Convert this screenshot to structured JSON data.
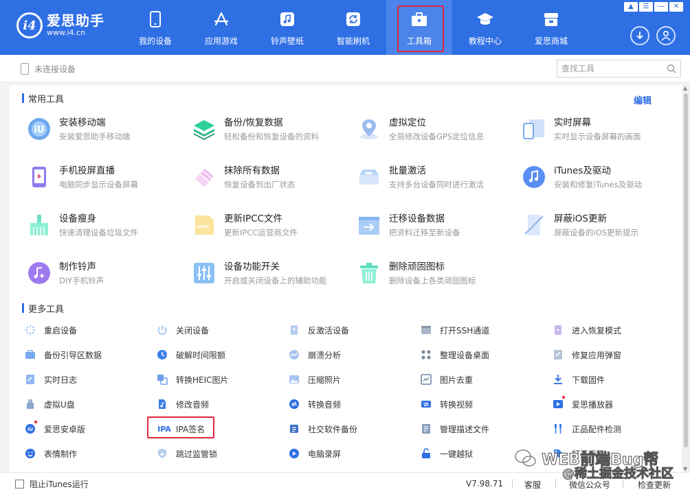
{
  "app": {
    "name": "爱思助手",
    "url": "www.i4.cn",
    "logo_mark": "i4",
    "accent_color": "#2f6fe4",
    "highlight_color": "#e3263a"
  },
  "nav": [
    {
      "label": "我的设备",
      "icon": "phone-icon"
    },
    {
      "label": "应用游戏",
      "icon": "appstore-icon"
    },
    {
      "label": "铃声壁纸",
      "icon": "music-icon"
    },
    {
      "label": "智能刷机",
      "icon": "refresh-icon"
    },
    {
      "label": "工具箱",
      "icon": "toolbox-icon",
      "active": true
    },
    {
      "label": "教程中心",
      "icon": "graduation-cap-icon"
    },
    {
      "label": "爱思商城",
      "icon": "store-icon"
    }
  ],
  "toolbar": {
    "device_status": "未连接设备",
    "search_placeholder": "查找工具"
  },
  "common_tools": {
    "title": "常用工具",
    "edit_label": "编辑",
    "items": [
      {
        "title": "安装移动端",
        "desc": "安装爱思助手移动端"
      },
      {
        "title": "备份/恢复数据",
        "desc": "轻松备份和恢复设备的资料"
      },
      {
        "title": "虚拟定位",
        "desc": "全局修改设备GPS定位信息"
      },
      {
        "title": "实时屏幕",
        "desc": "实时显示设备屏幕的画面"
      },
      {
        "title": "手机投屏直播",
        "desc": "电脑同步显示设备屏幕"
      },
      {
        "title": "抹除所有数据",
        "desc": "恢复设备到出厂状态"
      },
      {
        "title": "批量激活",
        "desc": "支持多台设备同时进行激活"
      },
      {
        "title": "iTunes及驱动",
        "desc": "安装和修复iTunes及驱动"
      },
      {
        "title": "设备瘦身",
        "desc": "快速清理设备垃圾文件"
      },
      {
        "title": "更新IPCC文件",
        "desc": "更新IPCC运营商文件"
      },
      {
        "title": "迁移设备数据",
        "desc": "把资料迁移至新设备"
      },
      {
        "title": "屏蔽iOS更新",
        "desc": "屏蔽设备的iOS更新提示"
      },
      {
        "title": "制作铃声",
        "desc": "DIY手机铃声"
      },
      {
        "title": "设备功能开关",
        "desc": "开启或关闭设备上的辅助功能"
      },
      {
        "title": "删除顽固图标",
        "desc": "删除设备上各类顽固图标"
      }
    ]
  },
  "more_tools": {
    "title": "更多工具",
    "items": [
      {
        "label": "重启设备"
      },
      {
        "label": "关闭设备"
      },
      {
        "label": "反激活设备"
      },
      {
        "label": "打开SSH通道"
      },
      {
        "label": "进入恢复模式"
      },
      {
        "label": "备份引导区数据"
      },
      {
        "label": "破解时间限额"
      },
      {
        "label": "崩溃分析"
      },
      {
        "label": "整理设备桌面"
      },
      {
        "label": "修复应用弹窗"
      },
      {
        "label": "实时日志"
      },
      {
        "label": "转换HEIC图片"
      },
      {
        "label": "压缩照片"
      },
      {
        "label": "图片去重"
      },
      {
        "label": "下载固件"
      },
      {
        "label": "虚拟U盘"
      },
      {
        "label": "修改音频"
      },
      {
        "label": "转换音频"
      },
      {
        "label": "转换视频"
      },
      {
        "label": "爱思播放器"
      },
      {
        "label": "爱思安卓版"
      },
      {
        "label": "IPA签名",
        "icon_text": "IPA"
      },
      {
        "label": "社交软件备份"
      },
      {
        "label": "管理描述文件"
      },
      {
        "label": "正品配件检测"
      },
      {
        "label": "表情制作"
      },
      {
        "label": "跳过监管锁"
      },
      {
        "label": "电脑录屏"
      },
      {
        "label": "一键越狱"
      },
      {
        "label": "打开标签"
      }
    ]
  },
  "footer": {
    "itunes_label": "阻止iTunes运行",
    "version": "V7.98.71",
    "service": "客服",
    "wechat": "微信公众号",
    "check_update": "检查更新"
  },
  "watermark": {
    "line1": "WEB前端Bug帮",
    "line2": "@稀土掘金技术社区"
  }
}
